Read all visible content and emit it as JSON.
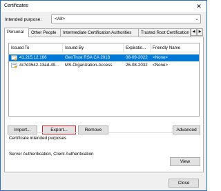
{
  "window": {
    "title": "Certificates",
    "close_glyph": "✕"
  },
  "purpose": {
    "label": "Intended purpose:",
    "value": "<All>"
  },
  "tabs": [
    {
      "label": "Personal",
      "active": true
    },
    {
      "label": "Other People",
      "active": false
    },
    {
      "label": "Intermediate Certification Authorities",
      "active": false
    },
    {
      "label": "Trusted Root Certification",
      "active": false
    }
  ],
  "tab_scroll": {
    "left": "◀",
    "right": "▶"
  },
  "list": {
    "columns": [
      "Issued To",
      "Issued By",
      "Expiratio...",
      "Friendly Name"
    ],
    "rows": [
      {
        "issued_to": "41.215.12.166",
        "issued_by": "GeoTrust RSA CA 2018",
        "expiration": "08-09-2022",
        "friendly_name": "<None>",
        "selected": true
      },
      {
        "issued_to": "4c7d3542-13ad-49...",
        "issued_by": "MS-Organization-Access",
        "expiration": "26-08-2032",
        "friendly_name": "<None>",
        "selected": false
      }
    ]
  },
  "buttons": {
    "import": "Import...",
    "export": "Export...",
    "remove": "Remove",
    "advanced": "Advanced",
    "view": "View",
    "close": "Close"
  },
  "purposes": {
    "title": "Certificate intended purposes",
    "value": "Server Authentication, Client Authentication"
  },
  "colors": {
    "selection": "#0078d7",
    "highlight_border": "#d0202a",
    "window_border": "#2b6fc2"
  }
}
